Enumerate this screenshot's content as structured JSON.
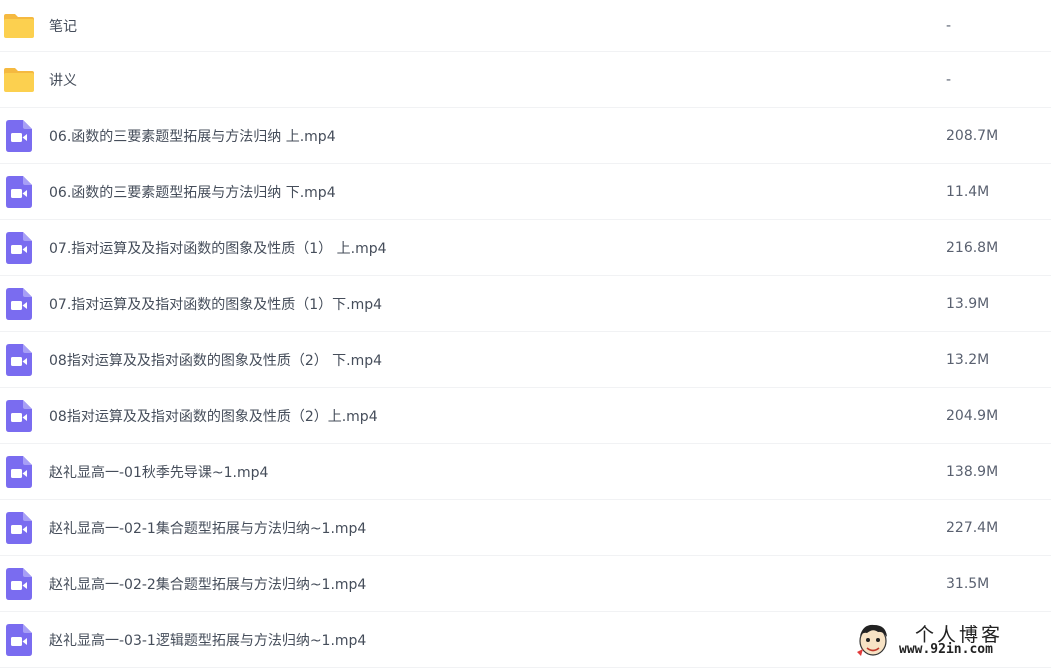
{
  "files": [
    {
      "name": "笔记",
      "size": "-",
      "type": "folder"
    },
    {
      "name": "讲义",
      "size": "-",
      "type": "folder"
    },
    {
      "name": "06.函数的三要素题型拓展与方法归纳 上.mp4",
      "size": "208.7M",
      "type": "video"
    },
    {
      "name": "06.函数的三要素题型拓展与方法归纳 下.mp4",
      "size": "11.4M",
      "type": "video"
    },
    {
      "name": "07.指对运算及及指对函数的图象及性质（1） 上.mp4",
      "size": "216.8M",
      "type": "video"
    },
    {
      "name": "07.指对运算及及指对函数的图象及性质（1）下.mp4",
      "size": "13.9M",
      "type": "video"
    },
    {
      "name": "08指对运算及及指对函数的图象及性质（2） 下.mp4",
      "size": "13.2M",
      "type": "video"
    },
    {
      "name": "08指对运算及及指对函数的图象及性质（2）上.mp4",
      "size": "204.9M",
      "type": "video"
    },
    {
      "name": "赵礼显高一-01秋季先导课~1.mp4",
      "size": "138.9M",
      "type": "video"
    },
    {
      "name": "赵礼显高一-02-1集合题型拓展与方法归纳~1.mp4",
      "size": "227.4M",
      "type": "video"
    },
    {
      "name": "赵礼显高一-02-2集合题型拓展与方法归纳~1.mp4",
      "size": "31.5M",
      "type": "video"
    },
    {
      "name": "赵礼显高一-03-1逻辑题型拓展与方法归纳~1.mp4",
      "size": "",
      "type": "video"
    }
  ],
  "icons": {
    "folder": "folder-icon",
    "video": "video-file-icon"
  },
  "colors": {
    "folder": "#fcd04f",
    "folder_tab": "#f5b940",
    "video": "#7a6cf0"
  },
  "watermark": {
    "title": "个人博客",
    "url": "www.92in.com"
  }
}
